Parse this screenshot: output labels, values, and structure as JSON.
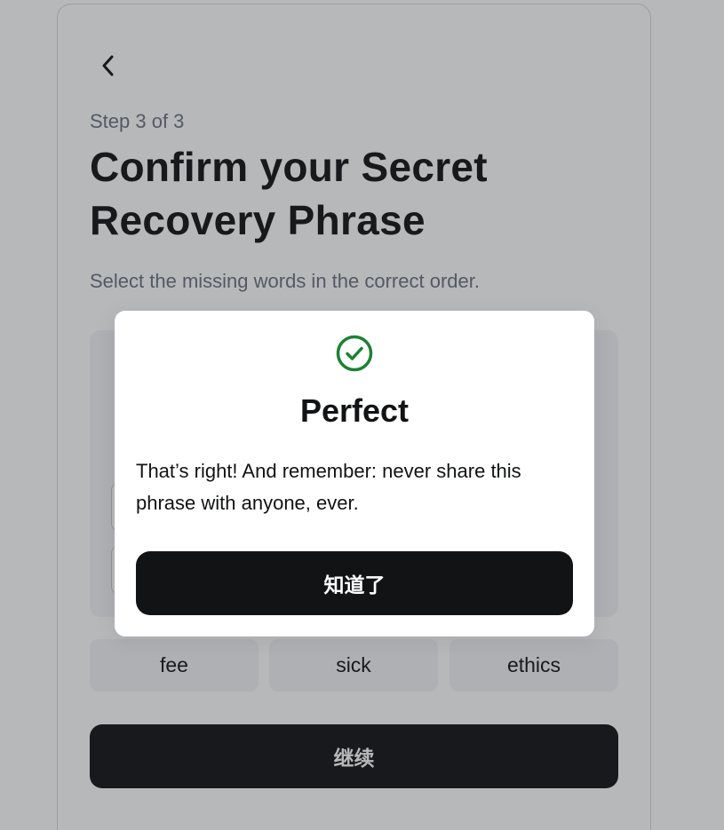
{
  "header": {
    "step": "Step 3 of 3",
    "title": "Confirm your Secret Recovery Phrase",
    "subtitle": "Select the missing words in the correct order."
  },
  "word_options": [
    "fee",
    "sick",
    "ethics"
  ],
  "continue_label": "继续",
  "modal": {
    "icon": "check-circle-icon",
    "title": "Perfect",
    "body": "That’s right! And remember: never share this phrase with anyone, ever.",
    "button_label": "知道了"
  },
  "colors": {
    "primary_button": "#121314",
    "success": "#1c8234",
    "muted_text": "#6b7280"
  }
}
